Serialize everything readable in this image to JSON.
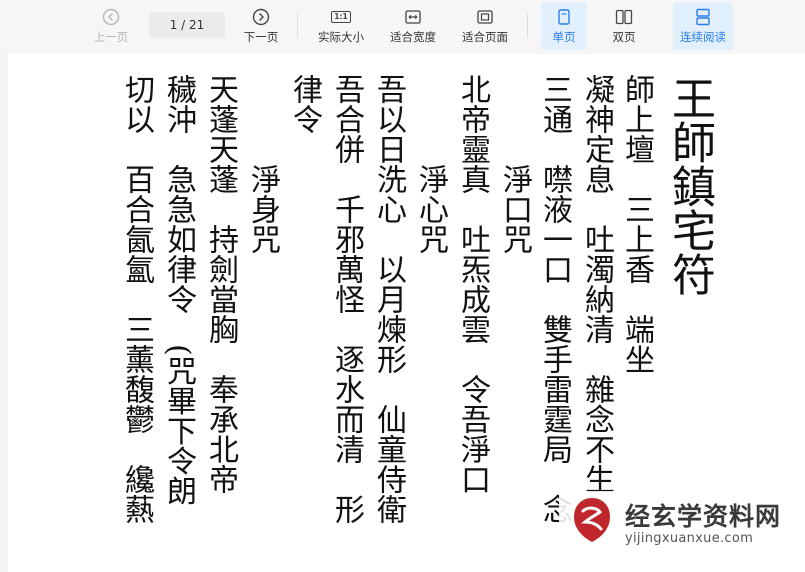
{
  "toolbar": {
    "prev_label": "上一页",
    "page_indicator": "1 / 21",
    "next_label": "下一页",
    "actual_size_label": "实际大小",
    "fit_width_label": "适合宽度",
    "fit_page_label": "适合页面",
    "single_page_label": "单页",
    "double_page_label": "双页",
    "continuous_label": "连续阅读",
    "actual_size_icon_text": "1:1",
    "accent_color": "#2b7de9"
  },
  "document": {
    "title": "王師鎮宅符",
    "columns": [
      "師上壇　三上香　端坐",
      "凝神定息　吐濁納清　雜念不生",
      "三通　噤液一口　雙手雷霆局　念",
      "　　淨口咒",
      "北帝靈真　吐炁成雲　令吾淨口",
      "　　淨心咒",
      "吾以日洗心　以月煉形　仙童侍衛",
      "吾合併　千邪萬怪　逐水而清　形",
      "律令",
      "　　淨身咒",
      "天蓬天蓬　持劍當胸　奉承北帝",
      "穢沖　急急如律令　(咒畢下令朗",
      "切以　百合氤氳　三薰馥鬱　纔爇"
    ]
  },
  "watermark": {
    "site_name": "经玄学资料网",
    "url": "yijingxuanxue.com"
  }
}
